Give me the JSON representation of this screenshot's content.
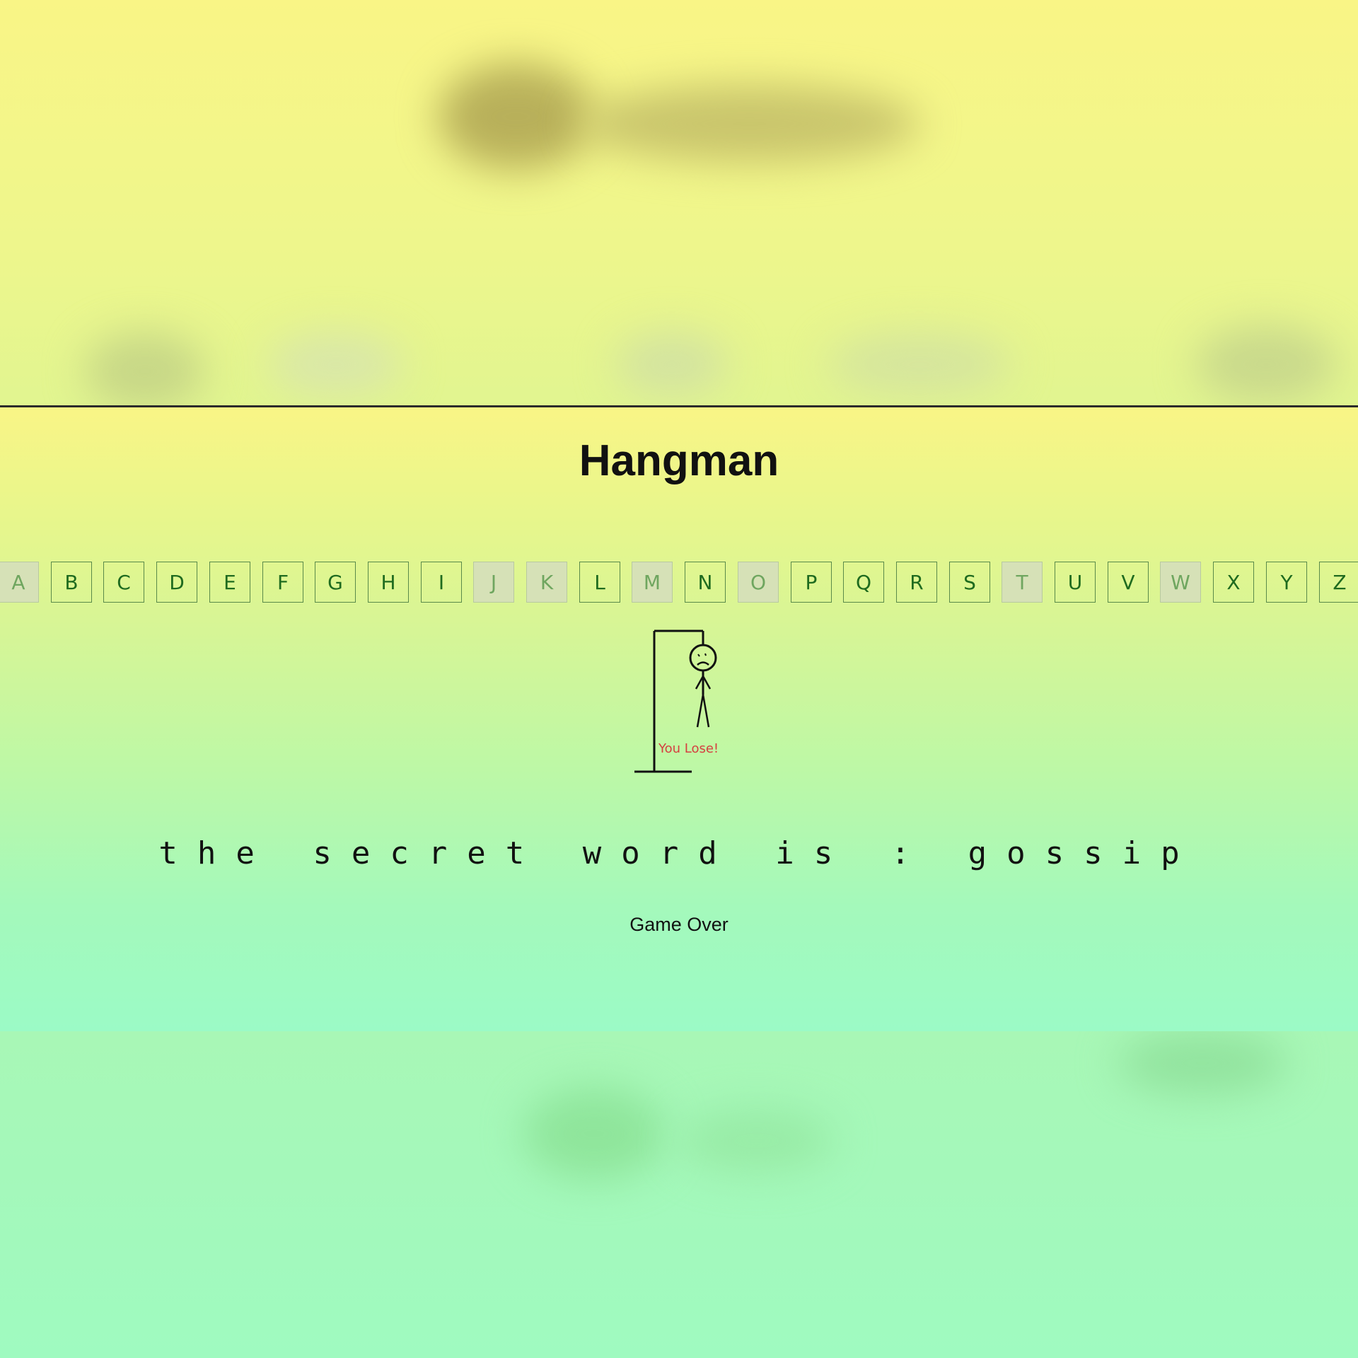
{
  "game": {
    "title": "Hangman",
    "letters": [
      {
        "label": "A",
        "used": true
      },
      {
        "label": "B",
        "used": false
      },
      {
        "label": "C",
        "used": false
      },
      {
        "label": "D",
        "used": false
      },
      {
        "label": "E",
        "used": false
      },
      {
        "label": "F",
        "used": false
      },
      {
        "label": "G",
        "used": false
      },
      {
        "label": "H",
        "used": false
      },
      {
        "label": "I",
        "used": false
      },
      {
        "label": "J",
        "used": true
      },
      {
        "label": "K",
        "used": true
      },
      {
        "label": "L",
        "used": false
      },
      {
        "label": "M",
        "used": true
      },
      {
        "label": "N",
        "used": false
      },
      {
        "label": "O",
        "used": true
      },
      {
        "label": "P",
        "used": false
      },
      {
        "label": "Q",
        "used": false
      },
      {
        "label": "R",
        "used": false
      },
      {
        "label": "S",
        "used": false
      },
      {
        "label": "T",
        "used": true
      },
      {
        "label": "U",
        "used": false
      },
      {
        "label": "V",
        "used": false
      },
      {
        "label": "W",
        "used": true
      },
      {
        "label": "X",
        "used": false
      },
      {
        "label": "Y",
        "used": false
      },
      {
        "label": "Z",
        "used": false
      }
    ],
    "lose_message": "You Lose!",
    "secret_word_line": "the secret word is : gossip",
    "status": "Game Over"
  },
  "colors": {
    "letter_text": "#1f6b1f",
    "lose_text": "#d54040"
  }
}
